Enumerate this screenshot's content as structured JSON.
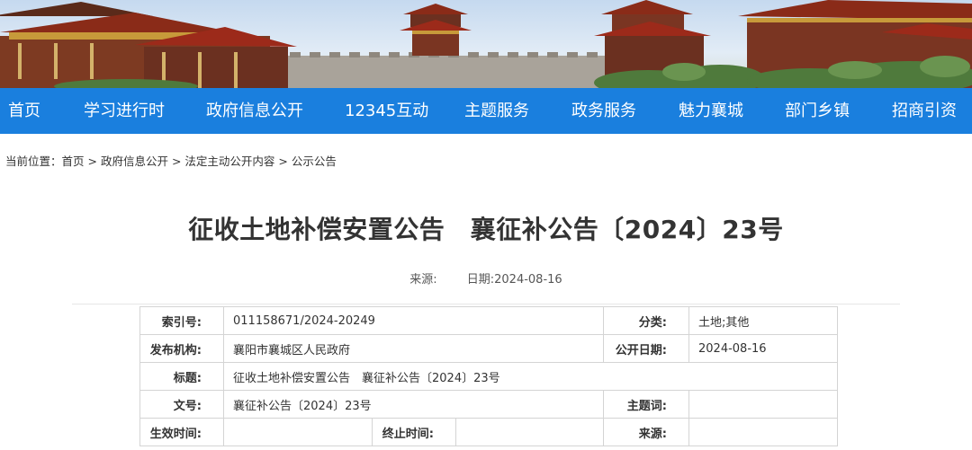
{
  "nav": {
    "items": [
      "首页",
      "学习进行时",
      "政府信息公开",
      "12345互动",
      "主题服务",
      "政务服务",
      "魅力襄城",
      "部门乡镇",
      "招商引资"
    ]
  },
  "breadcrumb": {
    "prefix": "当前位置：",
    "items": [
      "首页",
      "政府信息公开",
      "法定主动公开内容",
      "公示公告"
    ],
    "separator": " > "
  },
  "article": {
    "title": "征收土地补偿安置公告　襄征补公告〔2024〕23号",
    "source_label": "来源:",
    "source_value": "",
    "date_label": "日期:",
    "date_value": "2024-08-16"
  },
  "info_table": {
    "index_label": "索引号:",
    "index_value": "011158671/2024-20249",
    "category_label": "分类:",
    "category_value": "土地;其他",
    "publisher_label": "发布机构:",
    "publisher_value": "襄阳市襄城区人民政府",
    "pubdate_label": "公开日期:",
    "pubdate_value": "2024-08-16",
    "title_label": "标题:",
    "title_value": "征收土地补偿安置公告　襄征补公告〔2024〕23号",
    "docno_label": "文号:",
    "docno_value": "襄征补公告〔2024〕23号",
    "subject_label": "主题词:",
    "subject_value": "",
    "effective_label": "生效时间:",
    "effective_value": "",
    "expiry_label": "终止时间:",
    "expiry_value": "",
    "source_label": "来源:",
    "source_value": ""
  },
  "colors": {
    "nav_bg": "#1a7fde",
    "nav_text": "#ffffff",
    "roof_red": "#9c2a1a",
    "wall_grey": "#a9a39a",
    "foliage": "#4f7a3c"
  }
}
